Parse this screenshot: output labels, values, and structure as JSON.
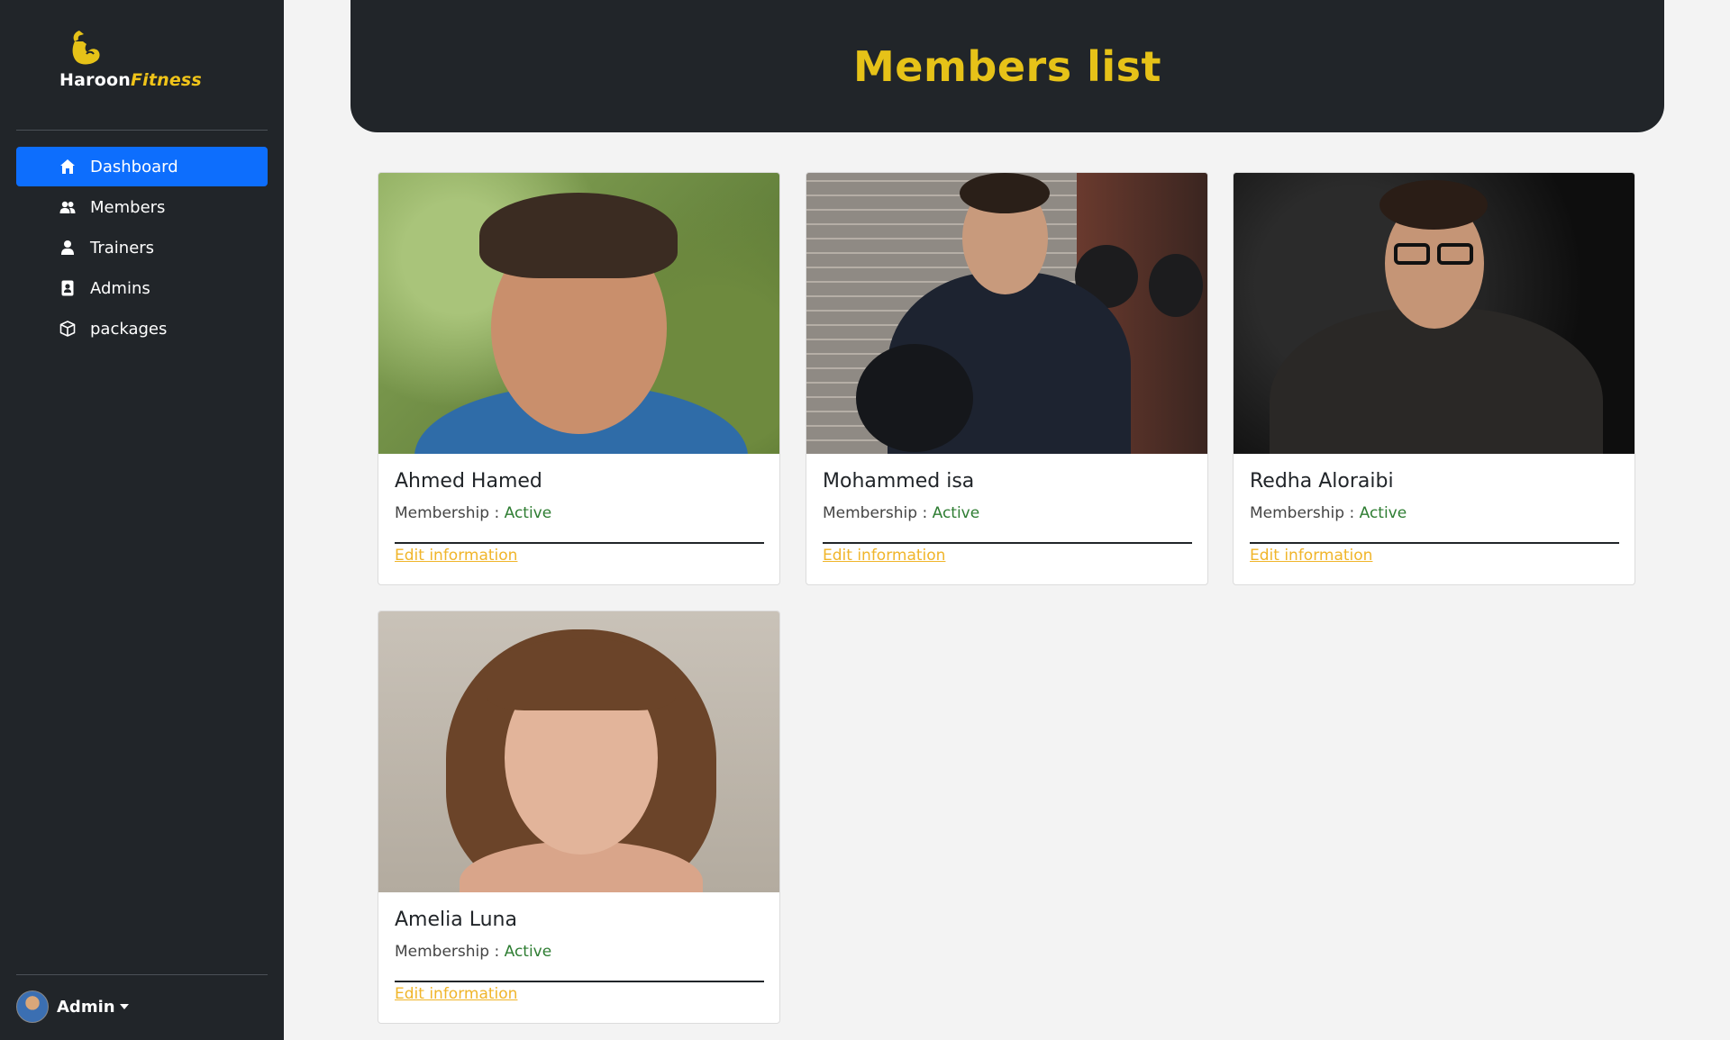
{
  "brand": {
    "name_part1": "Haroon",
    "name_part2": "Fitness",
    "logo_icon": "flexed-bicep-icon",
    "accent_color": "#f0c419"
  },
  "sidebar": {
    "items": [
      {
        "label": "Dashboard",
        "icon": "home-icon",
        "active": true
      },
      {
        "label": "Members",
        "icon": "users-icon",
        "active": false
      },
      {
        "label": "Trainers",
        "icon": "user-icon",
        "active": false
      },
      {
        "label": "Admins",
        "icon": "id-badge-icon",
        "active": false
      },
      {
        "label": "packages",
        "icon": "box-icon",
        "active": false
      }
    ],
    "active_color": "#0d6efd"
  },
  "user": {
    "name": "Admin",
    "menu_icon": "caret-down-icon"
  },
  "header": {
    "title": "Members list",
    "title_color": "#e6c218"
  },
  "members": [
    {
      "name": "Ahmed Hamed",
      "membership_label": "Membership :",
      "status": "Active",
      "edit_label": "Edit information"
    },
    {
      "name": "Mohammed isa",
      "membership_label": "Membership :",
      "status": "Active",
      "edit_label": "Edit information"
    },
    {
      "name": "Redha Aloraibi",
      "membership_label": "Membership :",
      "status": "Active",
      "edit_label": "Edit information"
    },
    {
      "name": "Amelia Luna",
      "membership_label": "Membership :",
      "status": "Active",
      "edit_label": "Edit information"
    }
  ]
}
